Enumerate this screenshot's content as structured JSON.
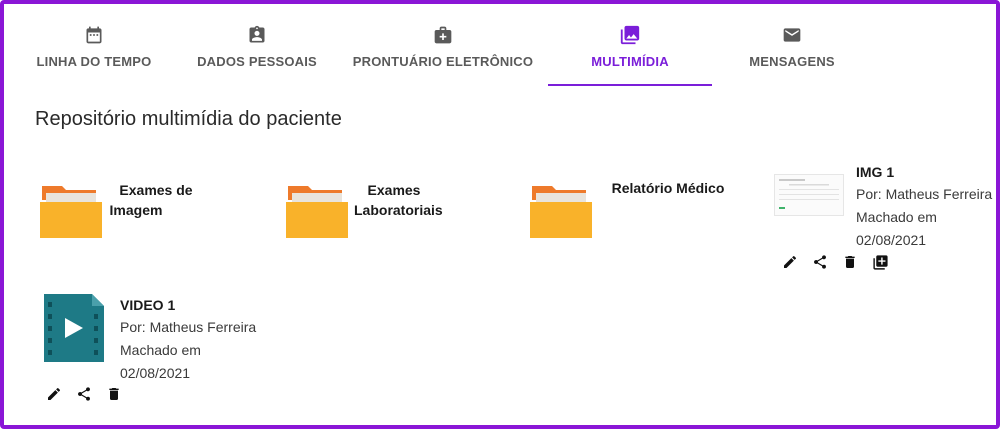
{
  "tabs": [
    {
      "label": "LINHA DO TEMPO",
      "icon": "calendar-icon",
      "active": false
    },
    {
      "label": "DADOS PESSOAIS",
      "icon": "assignment-ind-icon",
      "active": false
    },
    {
      "label": "PRONTUÁRIO ELETRÔNICO",
      "icon": "medical-bag-icon",
      "active": false
    },
    {
      "label": "MULTIMÍDIA",
      "icon": "photo-library-icon",
      "active": true
    },
    {
      "label": "MENSAGENS",
      "icon": "mail-icon",
      "active": false
    }
  ],
  "accent_color": "#7b1ed9",
  "frame_color": "#8a16d6",
  "folder_color": "#f9b22a",
  "folder_tab_color": "#ee7a2b",
  "video_color": "#1e7a86",
  "page_title": "Repositório multimídia do paciente",
  "folders": [
    {
      "label_line1": "Exames de",
      "label_line2": "Imagem"
    },
    {
      "label_line1": "Exames",
      "label_line2": "Laboratoriais"
    },
    {
      "label_line1": "Relatório Médico",
      "label_line2": ""
    }
  ],
  "image_file": {
    "title": "IMG 1",
    "author_line1": "Por: Matheus Ferreira",
    "author_line2": "Machado em",
    "date": "02/08/2021",
    "actions": [
      "edit-icon",
      "share-icon",
      "delete-icon",
      "add-to-library-icon"
    ]
  },
  "video_file": {
    "title": "VIDEO 1",
    "author_line1": "Por: Matheus Ferreira",
    "author_line2": "Machado em",
    "date": "02/08/2021",
    "actions": [
      "edit-icon",
      "share-icon",
      "delete-icon"
    ]
  }
}
